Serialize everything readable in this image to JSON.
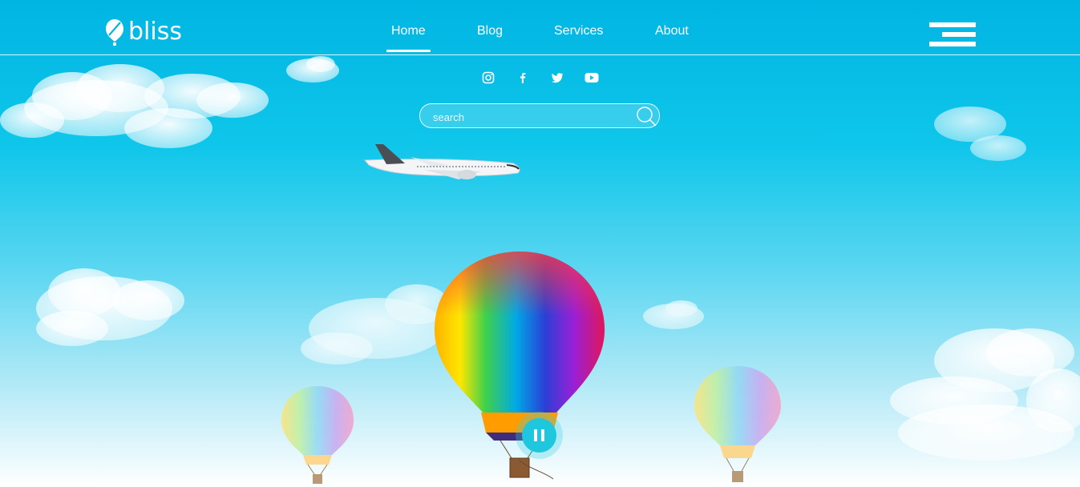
{
  "brand": {
    "name": "bliss"
  },
  "nav": {
    "items": [
      {
        "label": "Home",
        "active": true
      },
      {
        "label": "Blog",
        "active": false
      },
      {
        "label": "Services",
        "active": false
      },
      {
        "label": "About",
        "active": false
      }
    ]
  },
  "social": [
    "instagram-icon",
    "facebook-icon",
    "twitter-icon",
    "youtube-icon"
  ],
  "search": {
    "placeholder": "search",
    "value": ""
  },
  "media": {
    "state": "playing",
    "control": "pause"
  },
  "colors": {
    "sky_top": "#00b5e3",
    "sky_bottom": "#ffffff",
    "accent": "#1ec6de"
  }
}
